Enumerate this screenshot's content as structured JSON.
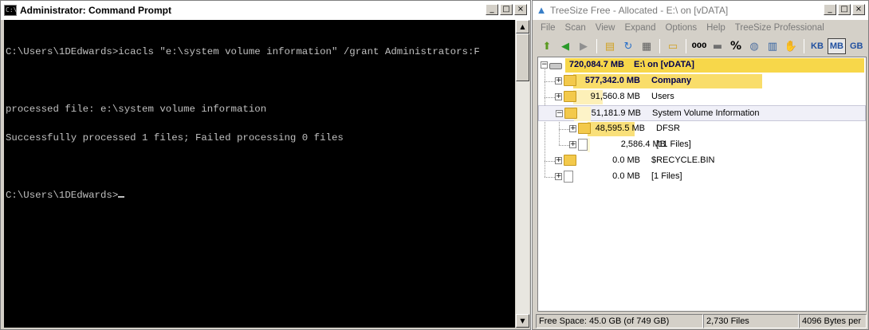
{
  "cmd": {
    "title": "Administrator: Command Prompt",
    "lines": [
      "C:\\Users\\1DEdwards>icacls \"e:\\system volume information\" /grant Administrators:F",
      "",
      "processed file: e:\\system volume information",
      "Successfully processed 1 files; Failed processing 0 files",
      "",
      "C:\\Users\\1DEdwards>"
    ],
    "icon": "cmd-console-icon"
  },
  "treesize": {
    "title": "TreeSize Free - Allocated - E:\\  on  [vDATA]",
    "menu": [
      "File",
      "Scan",
      "View",
      "Expand",
      "Options",
      "Help",
      "TreeSize Professional"
    ],
    "toolbar": {
      "icons": [
        "up-folder-icon",
        "back-icon",
        "forward-icon",
        "open-folder-icon",
        "refresh-icon",
        "print-icon",
        "export-icon",
        "number-format-icon",
        "drive-icon",
        "percent-icon",
        "size-icon",
        "columns-icon",
        "hand-icon"
      ],
      "number_label": "000",
      "percent_label": "%",
      "units": [
        "KB",
        "MB",
        "GB"
      ],
      "active_unit": "MB"
    },
    "tree": [
      {
        "size": "720,084.7 MB",
        "name": "E:\\  on  [vDATA]",
        "type": "drive",
        "bold": true,
        "bar_color": "#f7d74a",
        "fill_pct": 100
      },
      {
        "size": "577,342.0 MB",
        "name": "Company",
        "type": "folder",
        "bold": true,
        "bar_color": "#f9dd6a",
        "fill_pct": 80.2
      },
      {
        "size": "91,560.8 MB",
        "name": "Users",
        "type": "folder",
        "bold": false,
        "bar_color": "#fdf0b8",
        "fill_pct": 12.7
      },
      {
        "size": "51,181.9 MB",
        "name": "System Volume Information",
        "type": "folder",
        "bold": false,
        "bar_color": "#fdf3c8",
        "fill_pct": 7.1,
        "selected": true
      },
      {
        "size": "48,595.5 MB",
        "name": "DFSR",
        "type": "folder",
        "bold": false,
        "bar_color": "#f9e07a",
        "fill_pct": 94.9
      },
      {
        "size": "2,586.4 MB",
        "name": "[11 Files]",
        "type": "file",
        "bold": false,
        "bar_color": "#fff8d8",
        "fill_pct": 5.1
      },
      {
        "size": "0.0 MB",
        "name": "$RECYCLE.BIN",
        "type": "folder",
        "bold": false,
        "bar_color": "#ffffff",
        "fill_pct": 0
      },
      {
        "size": "0.0 MB",
        "name": "[1 Files]",
        "type": "file",
        "bold": false,
        "bar_color": "#ffffff",
        "fill_pct": 0
      }
    ],
    "status": {
      "free_space": "Free Space: 45.0 GB  (of 749 GB)",
      "files": "2,730  Files",
      "cluster": "4096 Bytes per"
    }
  },
  "window_controls": {
    "minimize": "_",
    "maximize": "□",
    "close": "×"
  }
}
